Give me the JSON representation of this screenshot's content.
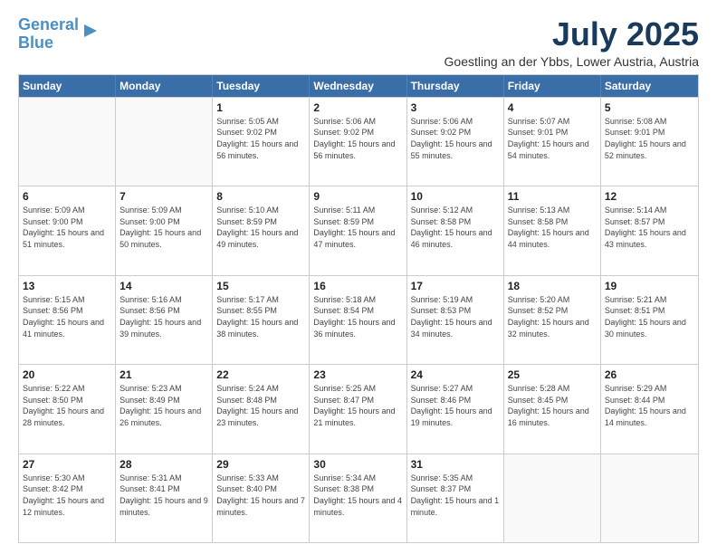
{
  "logo": {
    "line1": "General",
    "line2": "Blue"
  },
  "title": "July 2025",
  "location": "Goestling an der Ybbs, Lower Austria, Austria",
  "weekdays": [
    "Sunday",
    "Monday",
    "Tuesday",
    "Wednesday",
    "Thursday",
    "Friday",
    "Saturday"
  ],
  "rows": [
    [
      {
        "day": "",
        "info": ""
      },
      {
        "day": "",
        "info": ""
      },
      {
        "day": "1",
        "info": "Sunrise: 5:05 AM\nSunset: 9:02 PM\nDaylight: 15 hours and 56 minutes."
      },
      {
        "day": "2",
        "info": "Sunrise: 5:06 AM\nSunset: 9:02 PM\nDaylight: 15 hours and 56 minutes."
      },
      {
        "day": "3",
        "info": "Sunrise: 5:06 AM\nSunset: 9:02 PM\nDaylight: 15 hours and 55 minutes."
      },
      {
        "day": "4",
        "info": "Sunrise: 5:07 AM\nSunset: 9:01 PM\nDaylight: 15 hours and 54 minutes."
      },
      {
        "day": "5",
        "info": "Sunrise: 5:08 AM\nSunset: 9:01 PM\nDaylight: 15 hours and 52 minutes."
      }
    ],
    [
      {
        "day": "6",
        "info": "Sunrise: 5:09 AM\nSunset: 9:00 PM\nDaylight: 15 hours and 51 minutes."
      },
      {
        "day": "7",
        "info": "Sunrise: 5:09 AM\nSunset: 9:00 PM\nDaylight: 15 hours and 50 minutes."
      },
      {
        "day": "8",
        "info": "Sunrise: 5:10 AM\nSunset: 8:59 PM\nDaylight: 15 hours and 49 minutes."
      },
      {
        "day": "9",
        "info": "Sunrise: 5:11 AM\nSunset: 8:59 PM\nDaylight: 15 hours and 47 minutes."
      },
      {
        "day": "10",
        "info": "Sunrise: 5:12 AM\nSunset: 8:58 PM\nDaylight: 15 hours and 46 minutes."
      },
      {
        "day": "11",
        "info": "Sunrise: 5:13 AM\nSunset: 8:58 PM\nDaylight: 15 hours and 44 minutes."
      },
      {
        "day": "12",
        "info": "Sunrise: 5:14 AM\nSunset: 8:57 PM\nDaylight: 15 hours and 43 minutes."
      }
    ],
    [
      {
        "day": "13",
        "info": "Sunrise: 5:15 AM\nSunset: 8:56 PM\nDaylight: 15 hours and 41 minutes."
      },
      {
        "day": "14",
        "info": "Sunrise: 5:16 AM\nSunset: 8:56 PM\nDaylight: 15 hours and 39 minutes."
      },
      {
        "day": "15",
        "info": "Sunrise: 5:17 AM\nSunset: 8:55 PM\nDaylight: 15 hours and 38 minutes."
      },
      {
        "day": "16",
        "info": "Sunrise: 5:18 AM\nSunset: 8:54 PM\nDaylight: 15 hours and 36 minutes."
      },
      {
        "day": "17",
        "info": "Sunrise: 5:19 AM\nSunset: 8:53 PM\nDaylight: 15 hours and 34 minutes."
      },
      {
        "day": "18",
        "info": "Sunrise: 5:20 AM\nSunset: 8:52 PM\nDaylight: 15 hours and 32 minutes."
      },
      {
        "day": "19",
        "info": "Sunrise: 5:21 AM\nSunset: 8:51 PM\nDaylight: 15 hours and 30 minutes."
      }
    ],
    [
      {
        "day": "20",
        "info": "Sunrise: 5:22 AM\nSunset: 8:50 PM\nDaylight: 15 hours and 28 minutes."
      },
      {
        "day": "21",
        "info": "Sunrise: 5:23 AM\nSunset: 8:49 PM\nDaylight: 15 hours and 26 minutes."
      },
      {
        "day": "22",
        "info": "Sunrise: 5:24 AM\nSunset: 8:48 PM\nDaylight: 15 hours and 23 minutes."
      },
      {
        "day": "23",
        "info": "Sunrise: 5:25 AM\nSunset: 8:47 PM\nDaylight: 15 hours and 21 minutes."
      },
      {
        "day": "24",
        "info": "Sunrise: 5:27 AM\nSunset: 8:46 PM\nDaylight: 15 hours and 19 minutes."
      },
      {
        "day": "25",
        "info": "Sunrise: 5:28 AM\nSunset: 8:45 PM\nDaylight: 15 hours and 16 minutes."
      },
      {
        "day": "26",
        "info": "Sunrise: 5:29 AM\nSunset: 8:44 PM\nDaylight: 15 hours and 14 minutes."
      }
    ],
    [
      {
        "day": "27",
        "info": "Sunrise: 5:30 AM\nSunset: 8:42 PM\nDaylight: 15 hours and 12 minutes."
      },
      {
        "day": "28",
        "info": "Sunrise: 5:31 AM\nSunset: 8:41 PM\nDaylight: 15 hours and 9 minutes."
      },
      {
        "day": "29",
        "info": "Sunrise: 5:33 AM\nSunset: 8:40 PM\nDaylight: 15 hours and 7 minutes."
      },
      {
        "day": "30",
        "info": "Sunrise: 5:34 AM\nSunset: 8:38 PM\nDaylight: 15 hours and 4 minutes."
      },
      {
        "day": "31",
        "info": "Sunrise: 5:35 AM\nSunset: 8:37 PM\nDaylight: 15 hours and 1 minute."
      },
      {
        "day": "",
        "info": ""
      },
      {
        "day": "",
        "info": ""
      }
    ]
  ]
}
